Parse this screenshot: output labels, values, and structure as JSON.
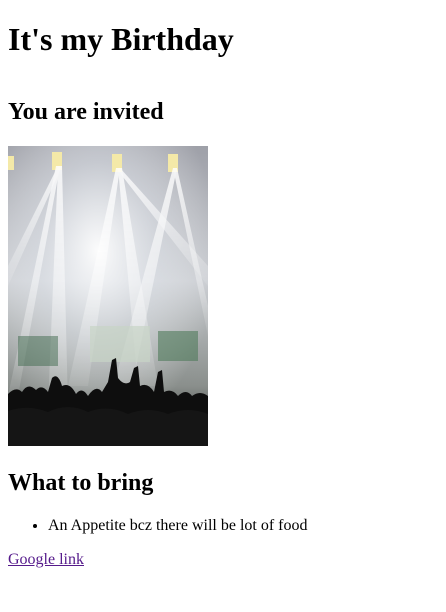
{
  "page": {
    "title": "It's my Birthday",
    "invited_heading": "You are invited",
    "bring_heading": "What to bring",
    "bring_items": [
      "An Appetite bcz there will be lot of food"
    ],
    "link_label": "Google link"
  },
  "colors": {
    "visited_link": "#551a8b",
    "text": "#000000",
    "background": "#ffffff"
  },
  "image": {
    "subject": "concert-crowd-stage-lights"
  }
}
